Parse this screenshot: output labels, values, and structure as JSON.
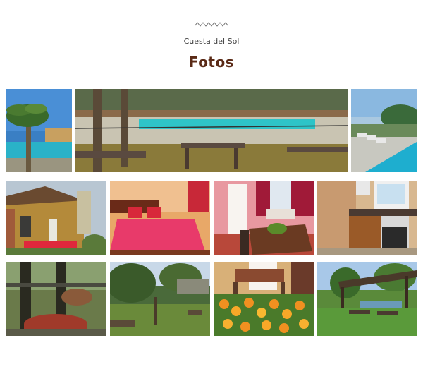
{
  "header": {
    "subtitle": "Cuesta del Sol",
    "title": "Fotos",
    "zigzag_icon": "zigzag-divider-icon"
  },
  "colors": {
    "title": "#5a2a16",
    "subtitle": "#444444",
    "background": "#ffffff"
  },
  "gallery": {
    "photos": [
      {
        "subject": "palm-tree-pool"
      },
      {
        "subject": "pool-with-picnic-tables"
      },
      {
        "subject": "pool-loungers"
      },
      {
        "subject": "house-exterior"
      },
      {
        "subject": "bedroom"
      },
      {
        "subject": "dining-room"
      },
      {
        "subject": "kitchen"
      },
      {
        "subject": "wooden-well"
      },
      {
        "subject": "garden-bench"
      },
      {
        "subject": "marigold-flowers"
      },
      {
        "subject": "garden-gazebo"
      }
    ]
  }
}
